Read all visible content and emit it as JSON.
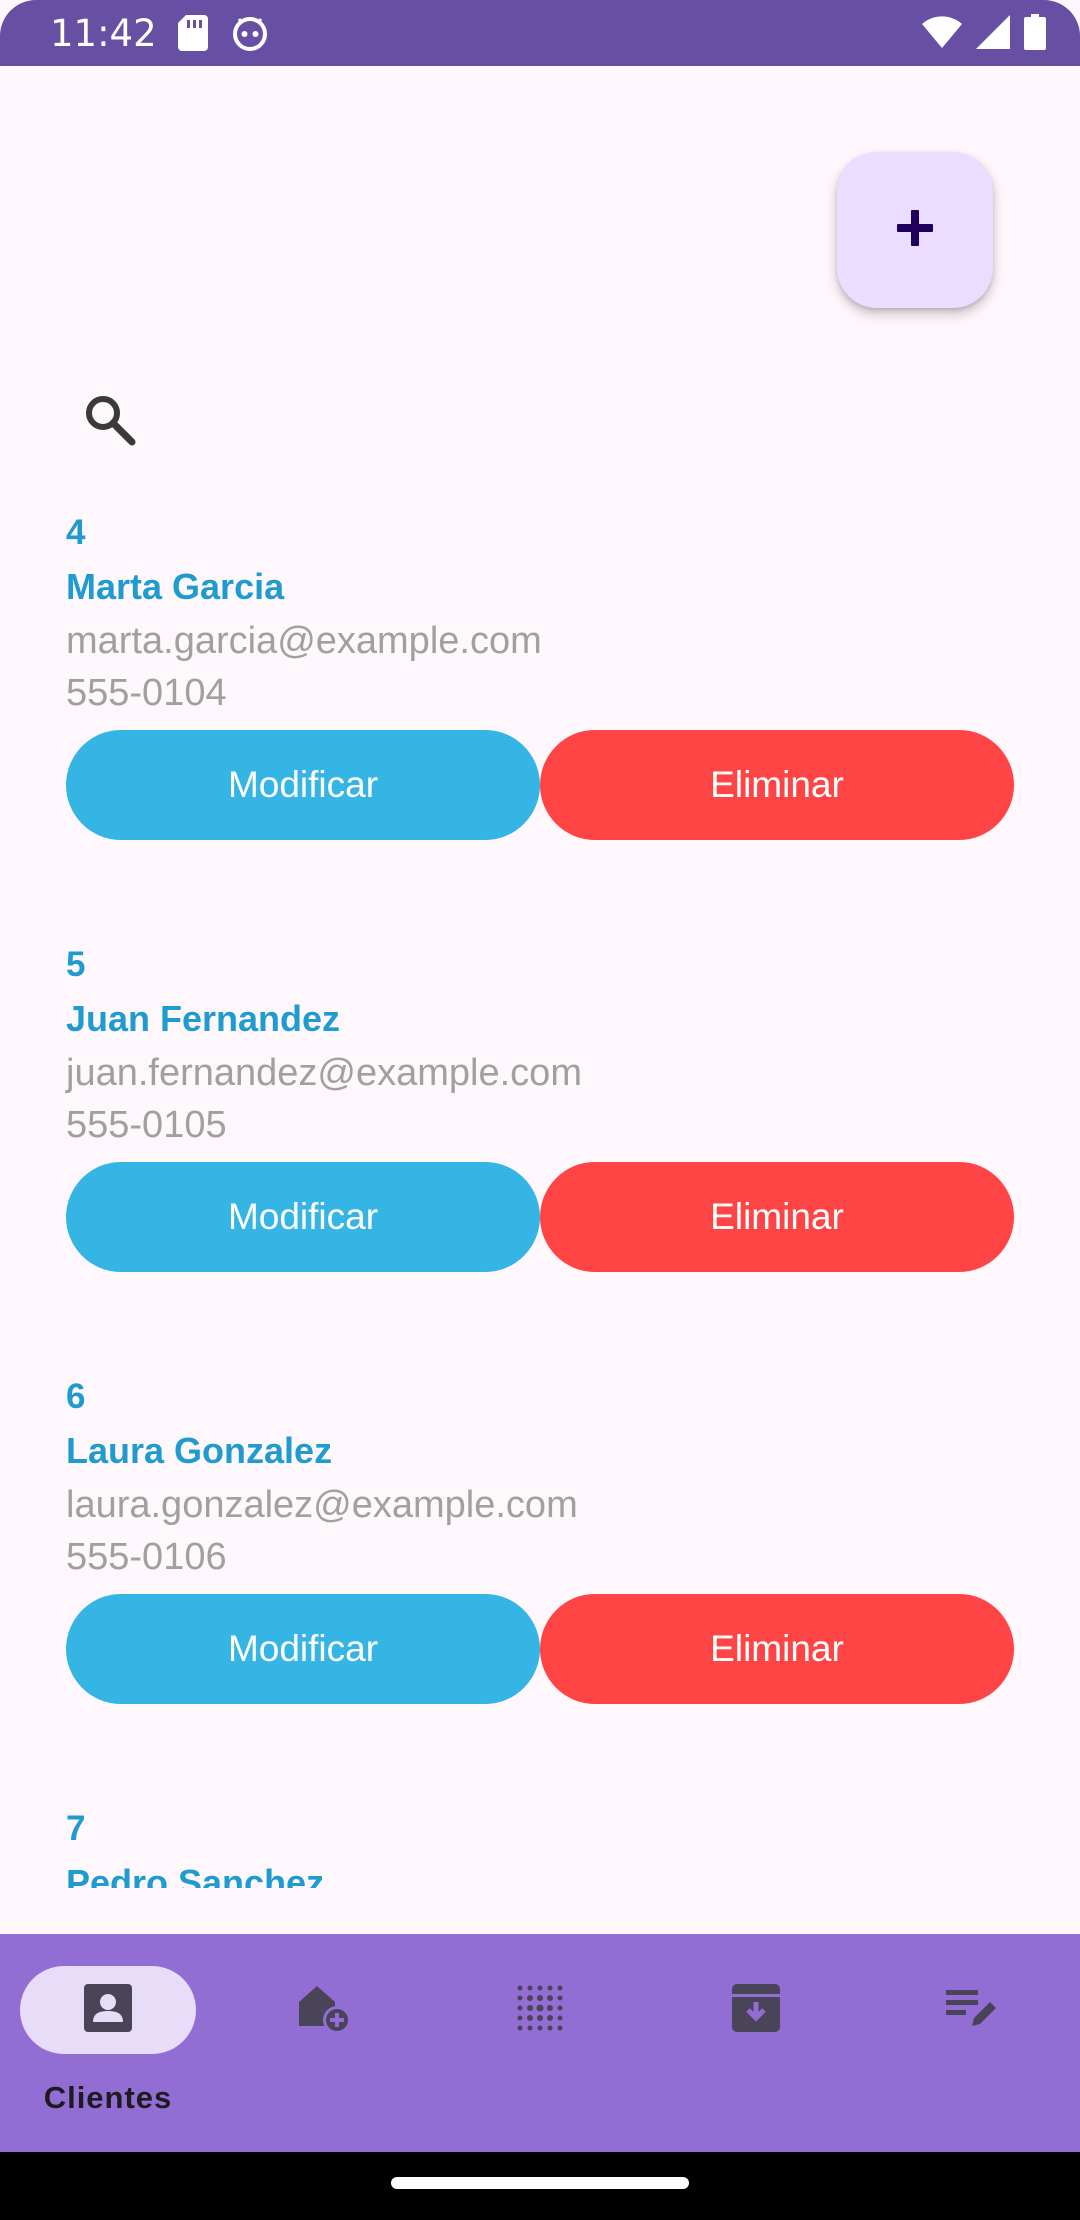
{
  "status_bar": {
    "time": "11:42",
    "left_icons": [
      "sd-card-icon",
      "android-debug-icon"
    ],
    "right_icons": [
      "wifi-icon",
      "cell-signal-icon",
      "battery-icon"
    ],
    "color": "#6750a4"
  },
  "fab": {
    "icon": "plus-icon"
  },
  "search": {
    "icon": "search-icon"
  },
  "clients": [
    {
      "id": "4",
      "name": "Marta Garcia",
      "email": "marta.garcia@example.com",
      "phone": "555-0104",
      "modify_label": "Modificar",
      "delete_label": "Eliminar"
    },
    {
      "id": "5",
      "name": "Juan Fernandez",
      "email": "juan.fernandez@example.com",
      "phone": "555-0105",
      "modify_label": "Modificar",
      "delete_label": "Eliminar"
    },
    {
      "id": "6",
      "name": "Laura Gonzalez",
      "email": "laura.gonzalez@example.com",
      "phone": "555-0106",
      "modify_label": "Modificar",
      "delete_label": "Eliminar"
    },
    {
      "id": "7",
      "name": "Pedro Sanchez"
    }
  ],
  "bottom_nav": {
    "items": [
      {
        "label": "Clientes",
        "icon": "contact-card-icon",
        "selected": true
      },
      {
        "icon": "add-home-icon",
        "selected": false
      },
      {
        "icon": "dot-grid-icon",
        "selected": false
      },
      {
        "icon": "archive-download-icon",
        "selected": false
      },
      {
        "icon": "edit-list-icon",
        "selected": false
      }
    ]
  },
  "colors": {
    "background": "#fef7fc",
    "accent_text": "#1f9bd0",
    "muted_text": "#a0a0a0",
    "modify_button": "#35b5e4",
    "delete_button": "#fe4444",
    "fab": "#eaddff",
    "nav_bar": "#926dd3",
    "nav_selected_pill": "#e8ddf9"
  }
}
